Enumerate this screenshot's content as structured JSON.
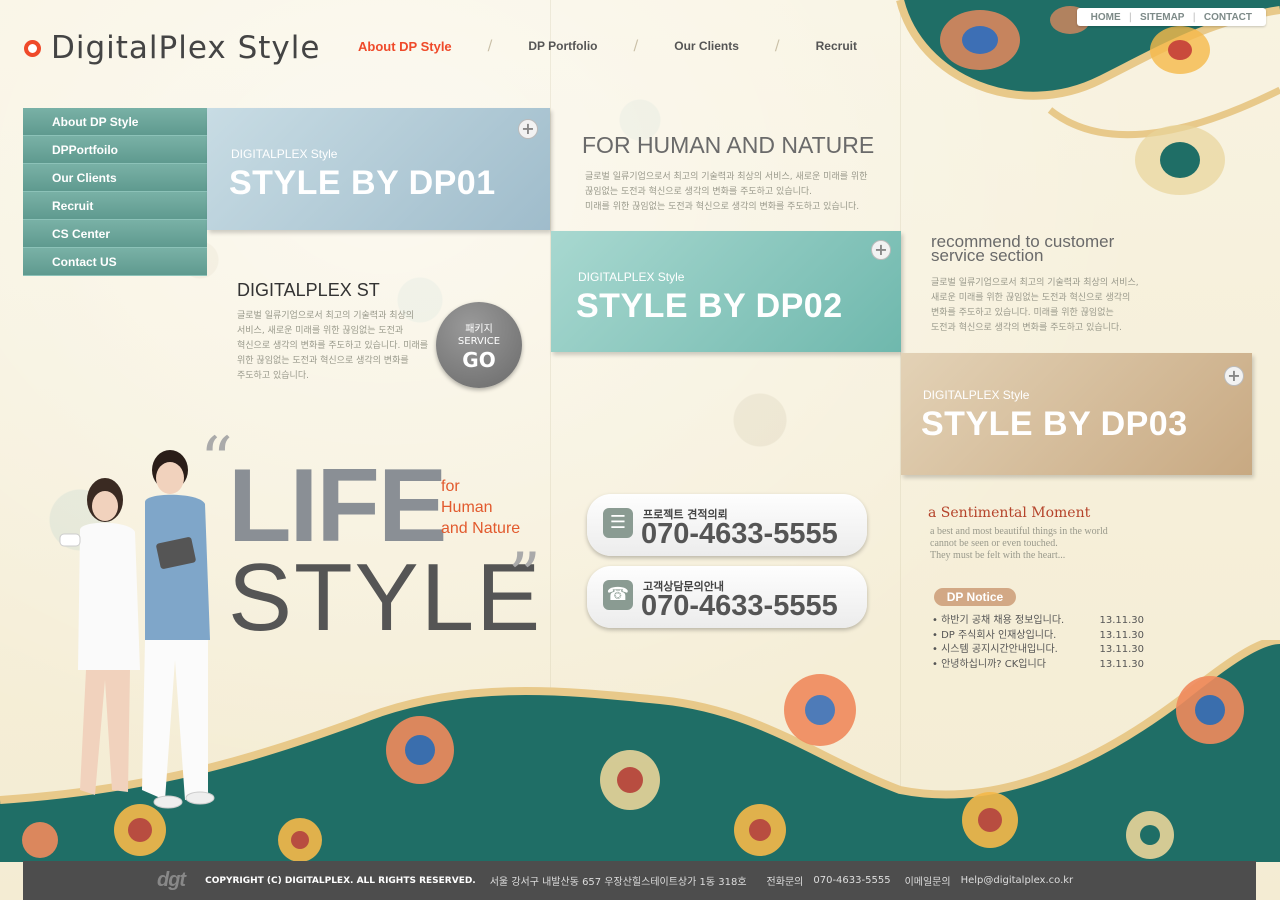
{
  "header": {
    "logo_text": "DigitalPlex Style",
    "gnb": [
      "About DP Style",
      "DP Portfolio",
      "Our Clients",
      "Recruit"
    ],
    "util": [
      "HOME",
      "SITEMAP",
      "CONTACT"
    ]
  },
  "lnb": [
    "About DP Style",
    "DPPortfoilo",
    "Our Clients",
    "Recruit",
    "CS Center",
    "Contact US"
  ],
  "cards": [
    {
      "sub": "DIGITALPLEX Style",
      "title": "STYLE BY DP01"
    },
    {
      "sub": "DIGITALPLEX Style",
      "title": "STYLE BY DP02"
    },
    {
      "sub": "DIGITALPLEX Style",
      "title": "STYLE BY DP03"
    }
  ],
  "nature": {
    "title": "FOR HUMAN AND NATURE",
    "line1": "글로벌 일류기업으로서 최고의 기술력과 최상의 서비스, 새로운 미래를 위한",
    "line2": "끊임없는 도전과 혁신으로 생각의 변화를 주도하고 있습니다.",
    "line3": "미래를 위한 끊임없는 도전과 혁신으로 생각의 변화를 주도하고 있습니다."
  },
  "recommend": {
    "title1": "recommend to customer",
    "title2": "service section",
    "line1": "글로벌 일류기업으로서 최고의 기술력과 최상의 서비스,",
    "line2": "새로운 미래를 위한 끊임없는 도전과 혁신으로 생각의",
    "line3": "변화를 주도하고 있습니다. 미래를 위한 끊임없는",
    "line4": "도전과 혁신으로 생각의 변화를 주도하고 있습니다."
  },
  "dpst": {
    "title": "DIGITALPLEX ST",
    "line1": "글로벌 일류기업으로서 최고의 기술력과 최상의",
    "line2": "서비스, 새로운 미래를 위한 끊임없는 도전과",
    "line3": "혁신으로 생각의 변화를 주도하고 있습니다. 미래를",
    "line4": "위한 끊임없는 도전과 혁신으로 생각의 변화를",
    "line5": "주도하고 있습니다."
  },
  "go_button": {
    "line1": "패키지",
    "line2": "SERVICE",
    "big": "GO"
  },
  "hero": {
    "open_quote": "“",
    "close_quote": "”",
    "life": "LIFE",
    "style": "STYLE",
    "for1": "for",
    "for2": "Human",
    "for3": "and Nature"
  },
  "phones": [
    {
      "label": "프로젝트 견적의뢰",
      "number": "070-4633-5555"
    },
    {
      "label": "고객상담문의안내",
      "number": "070-4633-5555"
    }
  ],
  "sentimental": {
    "title": "a Sentimental Moment",
    "line1": "a best and most beautiful things in the world",
    "line2": "cannot be seen or even touched.",
    "line3": "They must be felt with the heart..."
  },
  "notice": {
    "badge": "DP Notice",
    "items": [
      {
        "title": "하반기 공채 채용 정보입니다.",
        "date": "13.11.30"
      },
      {
        "title": "DP 주식회사 인재상입니다.",
        "date": "13.11.30"
      },
      {
        "title": "시스템 공지시간안내입니다.",
        "date": "13.11.30"
      },
      {
        "title": "안녕하십니까? CK입니다",
        "date": "13.11.30"
      }
    ]
  },
  "footer": {
    "logo": "dgt",
    "copyright": "COPYRIGHT (C) DIGITALPLEX. ALL RIGHTS RESERVED.",
    "address": "서울 강서구 내발산동 657 우장산힐스테이트상가 1동 318호",
    "tel_label": "전화문의",
    "tel": "070-4633-5555",
    "mail_label": "이메일문의",
    "mail": "Help@digitalplex.co.kr"
  },
  "colors": {
    "accent": "#ef4a2a",
    "nav_green": "#6fa89d",
    "teal_decor": "#1f6e66",
    "footer_bg": "#4d4d4d"
  }
}
